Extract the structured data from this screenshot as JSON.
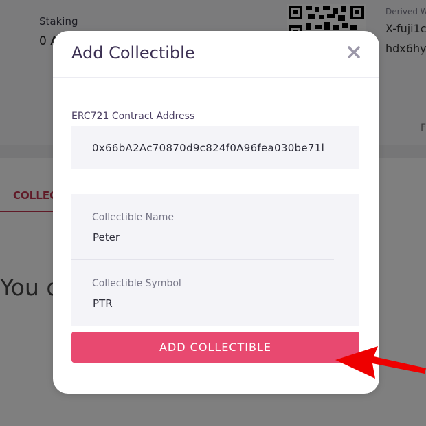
{
  "background": {
    "staking_label": "Staking",
    "staking_value": "0 A",
    "derived_label": "Derived W",
    "derived_address_line1": "X-fuji1c",
    "derived_address_line2": "hdx6hy",
    "right_char": "F",
    "tab_label": "COLLEC",
    "empty_text": "You d"
  },
  "modal": {
    "title": "Add Collectible",
    "close_icon": "close-icon",
    "contract_address": {
      "label": "ERC721 Contract Address",
      "value": "0x66bA2Ac70870d9c824f0A96fea030be71l"
    },
    "collectible_name": {
      "label": "Collectible Name",
      "value": "Peter"
    },
    "collectible_symbol": {
      "label": "Collectible Symbol",
      "value": "PTR"
    },
    "submit_label": "ADD COLLECTIBLE"
  },
  "colors": {
    "accent": "#e84970",
    "title": "#3b2f52",
    "annotation_arrow": "#ee0000"
  }
}
